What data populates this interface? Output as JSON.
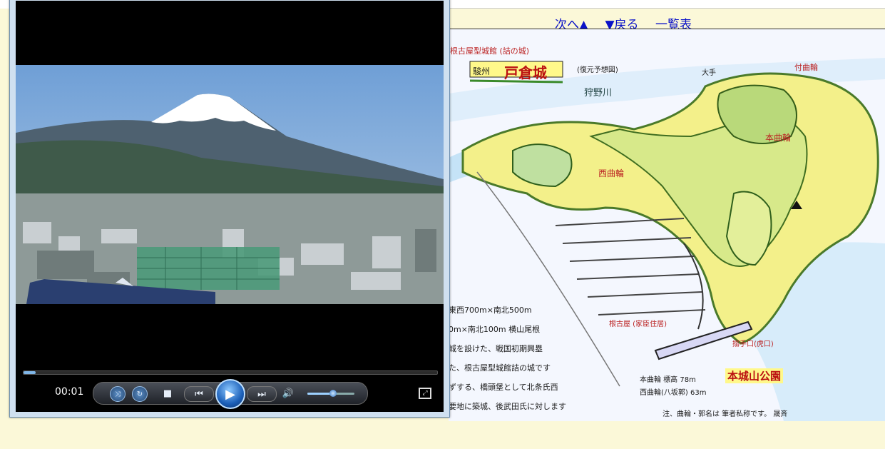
{
  "browser": {},
  "nav": {
    "next_label": "次へ▲",
    "back_label": "▼戻る",
    "list_label": "一覧表"
  },
  "map": {
    "heading_small": "根古屋型城館 (詰の城)",
    "province": "駿州",
    "castle_name": "戸倉城",
    "restore_note": "(復元予想図)",
    "river": "狩野川",
    "labels": {
      "honkuruwa": "本曲輪",
      "nishikuruwa": "西曲輪",
      "tsukekuruwa": "付曲輪",
      "oote": "大手",
      "negoya": "根古屋 (家臣住居)",
      "nekoguchi": "搦手口(虎口)",
      "park": "本城山公園"
    },
    "notes": [
      "東西700m×南北500m",
      "0m×南北100m 横山尾根",
      "城を設けた、戦国初期興塁",
      "た、根古屋型城館詰の城です",
      "ずする、橋頭堡として北条氏西",
      "要地に築城、後武田氏に対します"
    ],
    "elevations": [
      "本曲輪 標高 78m",
      "西曲輪(八坂郭) 63m"
    ],
    "bottom_note": "注、曲輪・郭名は 筆者私称です。 晟斉"
  },
  "player": {
    "time": "00:01",
    "progress_fraction": 0.03,
    "volume_fraction": 0.55
  }
}
